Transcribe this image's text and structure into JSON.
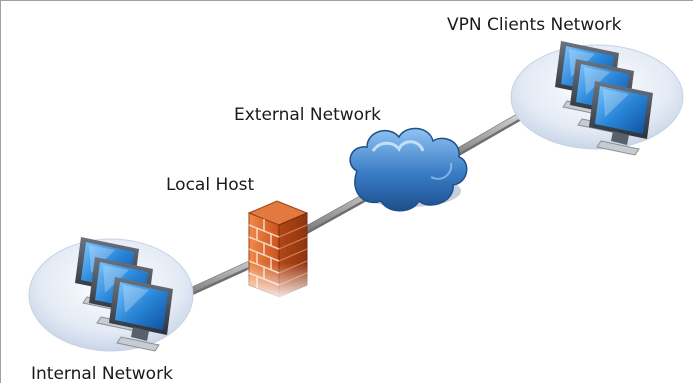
{
  "nodes": {
    "vpn_clients": {
      "label": "VPN Clients Network"
    },
    "external": {
      "label": "External Network"
    },
    "local_host": {
      "label": "Local Host"
    },
    "internal": {
      "label": "Internal Network"
    }
  },
  "colors": {
    "cable": "#9a9a9a",
    "platform": "#dfe7f2",
    "monitor_screen": "#2a86d8",
    "cloud": "#3a7cc4",
    "brick": "#d9642a"
  },
  "icons": {
    "vpn_clients": "computer-group-icon",
    "external": "cloud-icon",
    "local_host": "firewall-icon",
    "internal": "computer-group-icon"
  }
}
